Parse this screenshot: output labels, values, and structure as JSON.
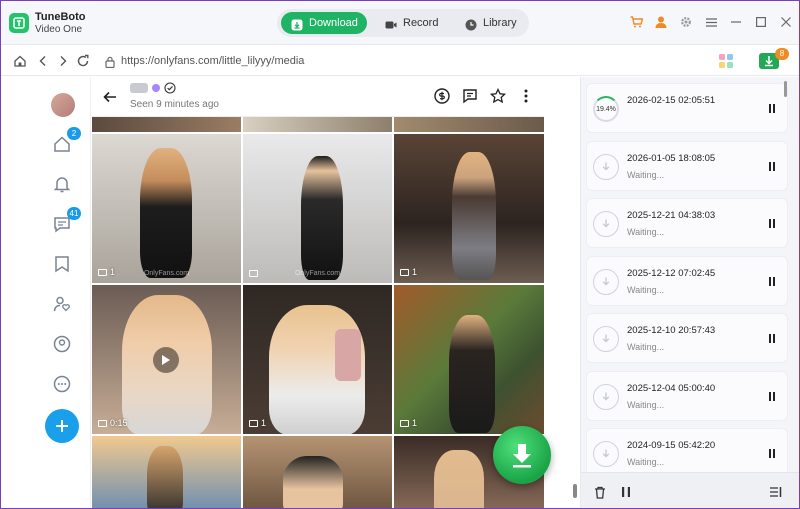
{
  "app": {
    "name": "TuneBoto",
    "subtitle": "Video One"
  },
  "modes": [
    {
      "label": "Download",
      "icon": "download-icon",
      "active": true
    },
    {
      "label": "Record",
      "icon": "record-icon",
      "active": false
    },
    {
      "label": "Library",
      "icon": "library-icon",
      "active": false
    }
  ],
  "address": {
    "url": "https://onlyfans.com/little_lilyyy/media"
  },
  "download_queue_count": "8",
  "leftnav": {
    "home_badge": "2",
    "messages_badge": "41"
  },
  "profile": {
    "seen": "Seen  9 minutes ago"
  },
  "tiles": [
    {
      "cap": "1",
      "type": "image"
    },
    {
      "cap": "",
      "type": "image"
    },
    {
      "cap": "1",
      "type": "image"
    },
    {
      "cap": "0:15",
      "type": "video"
    },
    {
      "cap": "1",
      "type": "image"
    },
    {
      "cap": "1",
      "type": "image"
    }
  ],
  "watermark": "OnlyFans.com",
  "tasks": [
    {
      "date": "2026-02-15 02:05:51",
      "status": "",
      "progress": "19.4%",
      "active": true
    },
    {
      "date": "2026-01-05 18:08:05",
      "status": "Waiting...",
      "progress": "",
      "active": false
    },
    {
      "date": "2025-12-21 04:38:03",
      "status": "Waiting...",
      "progress": "",
      "active": false
    },
    {
      "date": "2025-12-12 07:02:45",
      "status": "Waiting...",
      "progress": "",
      "active": false
    },
    {
      "date": "2025-12-10 20:57:43",
      "status": "Waiting...",
      "progress": "",
      "active": false
    },
    {
      "date": "2025-12-04 05:00:40",
      "status": "Waiting...",
      "progress": "",
      "active": false
    },
    {
      "date": "2024-09-15 05:42:20",
      "status": "Waiting...",
      "progress": "",
      "active": false
    }
  ],
  "colors": {
    "accent_green": "#1fb463",
    "badge_blue": "#1a9bea",
    "fab_blue": "#1aa0ea",
    "cart_orange": "#f08a24"
  }
}
